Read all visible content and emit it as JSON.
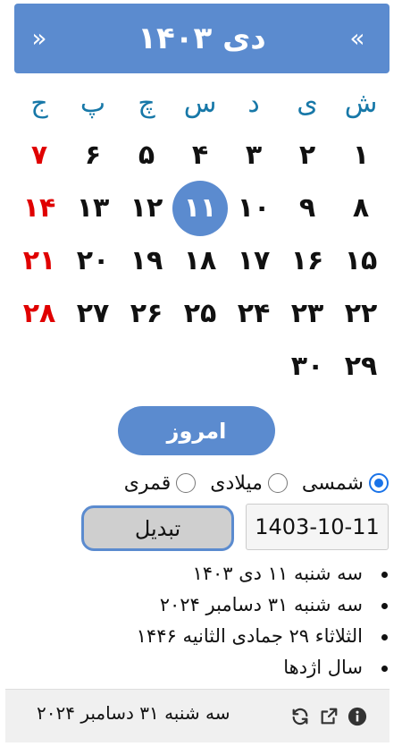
{
  "header": {
    "title": "دی ۱۴۰۳",
    "next_label": "«",
    "prev_label": "»"
  },
  "calendar": {
    "weekdays": [
      "ش",
      "ی",
      "د",
      "س",
      "چ",
      "پ",
      "ج"
    ],
    "weeks": [
      [
        "۱",
        "۲",
        "۳",
        "۴",
        "۵",
        "۶",
        "۷"
      ],
      [
        "۸",
        "۹",
        "۱۰",
        "۱۱",
        "۱۲",
        "۱۳",
        "۱۴"
      ],
      [
        "۱۵",
        "۱۶",
        "۱۷",
        "۱۸",
        "۱۹",
        "۲۰",
        "۲۱"
      ],
      [
        "۲۲",
        "۲۳",
        "۲۴",
        "۲۵",
        "۲۶",
        "۲۷",
        "۲۸"
      ],
      [
        "۲۹",
        "۳۰",
        "",
        "",
        "",
        "",
        ""
      ]
    ],
    "today": "۱۱",
    "holiday_color": "#e00000"
  },
  "today_button": "امروز",
  "calendar_types": [
    {
      "label": "شمسی",
      "checked": true
    },
    {
      "label": "میلادی",
      "checked": false
    },
    {
      "label": "قمری",
      "checked": false
    }
  ],
  "converter": {
    "date_value": "1403-10-11",
    "convert_label": "تبدیل"
  },
  "results": [
    "سه شنبه ۱۱ دی ۱۴۰۳",
    "سه شنبه ۳۱ دسامبر ۲۰۲۴",
    "الثلاثاء ۲۹ جمادی الثانیه ۱۴۴۶",
    "سال اژدها"
  ],
  "footer": {
    "text": "سه شنبه ۳۱ دسامبر ۲۰۲۴",
    "icons": [
      "info-icon",
      "external-link-icon",
      "refresh-icon"
    ]
  },
  "colors": {
    "accent": "#5b8bcf",
    "weekday": "#1778a8"
  }
}
